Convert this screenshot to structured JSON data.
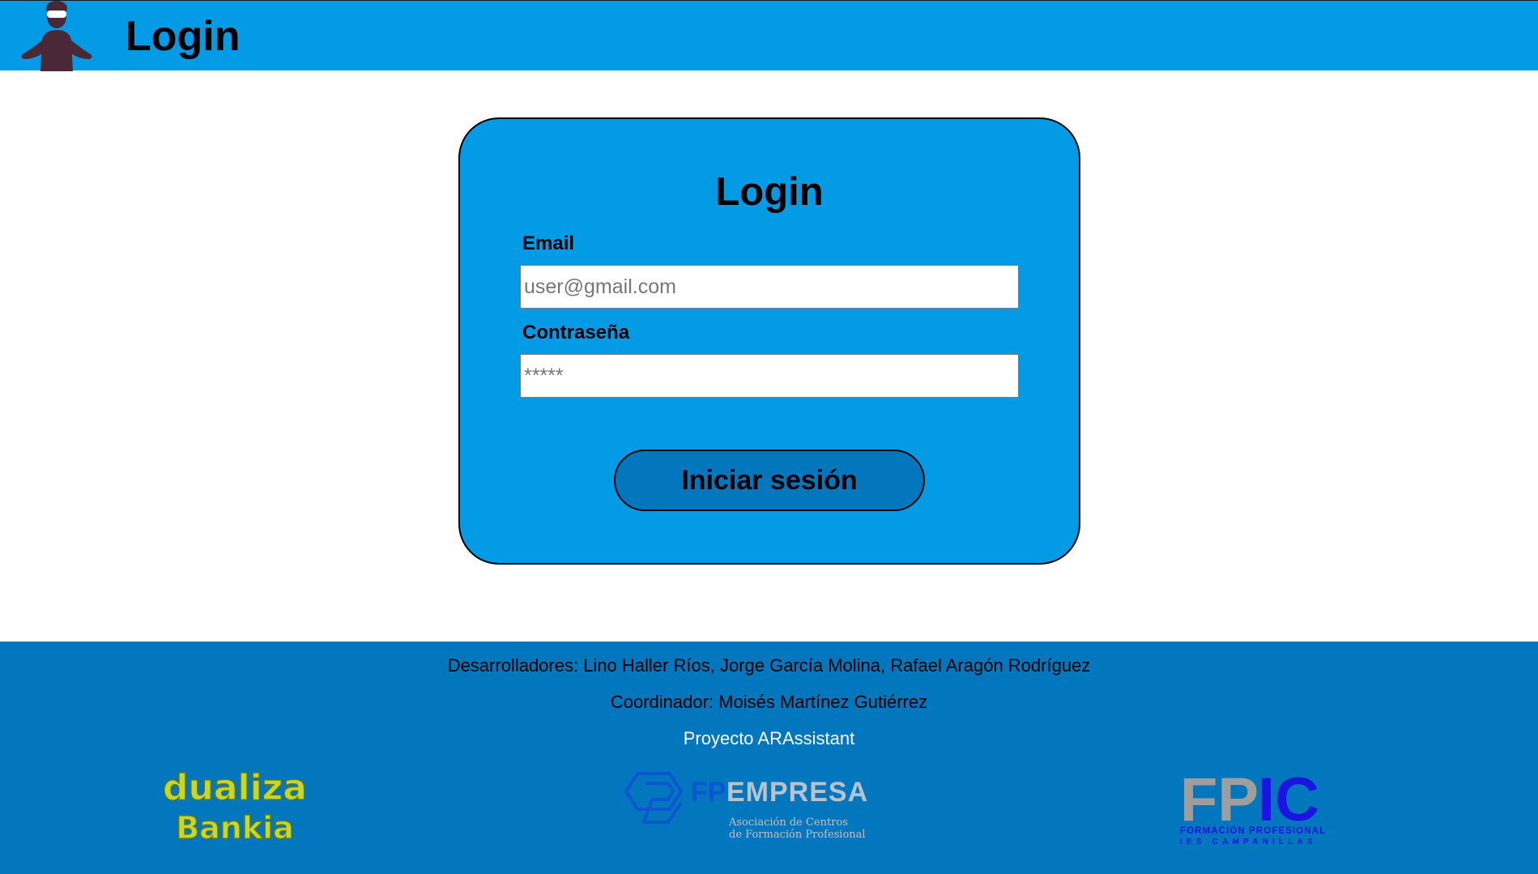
{
  "header": {
    "title": "Login"
  },
  "login_form": {
    "title": "Login",
    "email_label": "Email",
    "email_placeholder": "user@gmail.com",
    "email_value": "",
    "password_label": "Contraseña",
    "password_placeholder": "*****",
    "password_value": "",
    "submit_label": "Iniciar sesión"
  },
  "footer": {
    "developers": "Desarrolladores: Lino Haller Ríos, Jorge García Molina, Rafael Aragón Rodríguez",
    "coordinator": "Coordinador: Moisés Martínez Gutiérrez",
    "project": "Proyecto ARAssistant",
    "logos": [
      {
        "name": "dualiza-bankia-logo",
        "line1": "dualiza",
        "line2": "Bankia"
      },
      {
        "name": "fpempresa-logo",
        "brand_fp": "FP",
        "brand_rest": "EMPRESA",
        "sub1": "Asociación de Centros",
        "sub2": "de Formación Profesional"
      },
      {
        "name": "fpic-logo",
        "brand_fp": "FP",
        "brand_ic": "IC",
        "sub1": "FORMACIÓN PROFESIONAL",
        "sub2": "IES CAMPANILLAS"
      }
    ]
  },
  "colors": {
    "header_bg": "#039be5",
    "card_bg": "#039be5",
    "footer_bg": "#0277bd",
    "button_bg": "#0277bd",
    "dualiza_green": "#c6d62c",
    "fpic_gray": "#9e9e9e",
    "fpic_blue": "#1a14e0"
  },
  "icons": {
    "avatar": "person-with-vr-glasses-icon"
  }
}
